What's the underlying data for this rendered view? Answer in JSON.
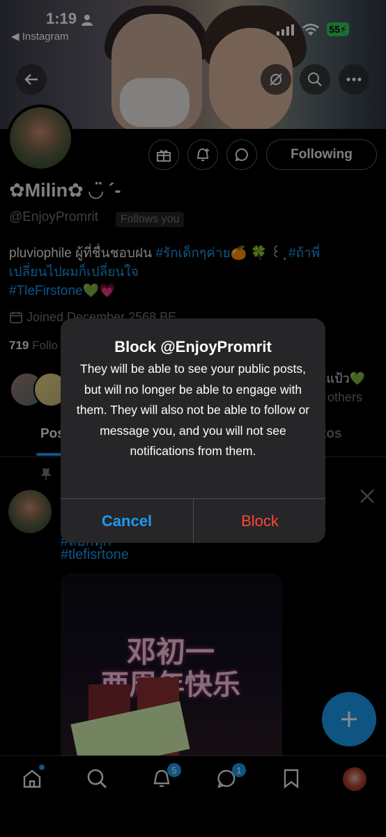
{
  "status_bar": {
    "time": "1:19",
    "back_app": "Instagram",
    "battery": "55"
  },
  "profile": {
    "display_name": "✿Milin✿ ◡̈ ´-",
    "handle": "@EnjoyPromrit",
    "follows_you": "Follows you",
    "bio_line1_text": "pluviophile ผู้ที่ชื่นชอบฝน ",
    "bio_line1_tag": "#รักเด็กๆค่าย",
    "bio_line1_emoji": "🍊 🍀 ꒰ ͙ ",
    "bio_line1_tag2": "#ถ้าพี่",
    "bio_line2_tag": "เปลี่ยนไปผมก็เปลี่ยนใจ",
    "bio_line3_tag": "#TleFirstone",
    "bio_line3_emoji": "💚💗",
    "joined": "Joined December 2568 BE",
    "following_count": "719",
    "following_label": "Follo",
    "followed_by_suffix": "ยแป้ว💚",
    "followed_by_others": "others",
    "follow_button": "Following"
  },
  "tabs": {
    "posts": "Pos",
    "photos": "tos"
  },
  "post": {
    "hashtag1": "#ล็อกทุก",
    "hashtag2": "#tlefisrtone",
    "image_text1": "邓初一",
    "image_text2": "两周年快乐"
  },
  "modal": {
    "title": "Block @EnjoyPromrit",
    "message": "They will be able to see your public posts, but will no longer be able to engage with them. They will also not be able to follow or message you, and you will not see notifications from them.",
    "cancel": "Cancel",
    "confirm": "Block"
  },
  "nav": {
    "notifications_badge": "5",
    "messages_badge": "1"
  },
  "colors": {
    "accent": "#1d9bf0",
    "destructive": "#ff453a",
    "battery": "#34c759"
  }
}
